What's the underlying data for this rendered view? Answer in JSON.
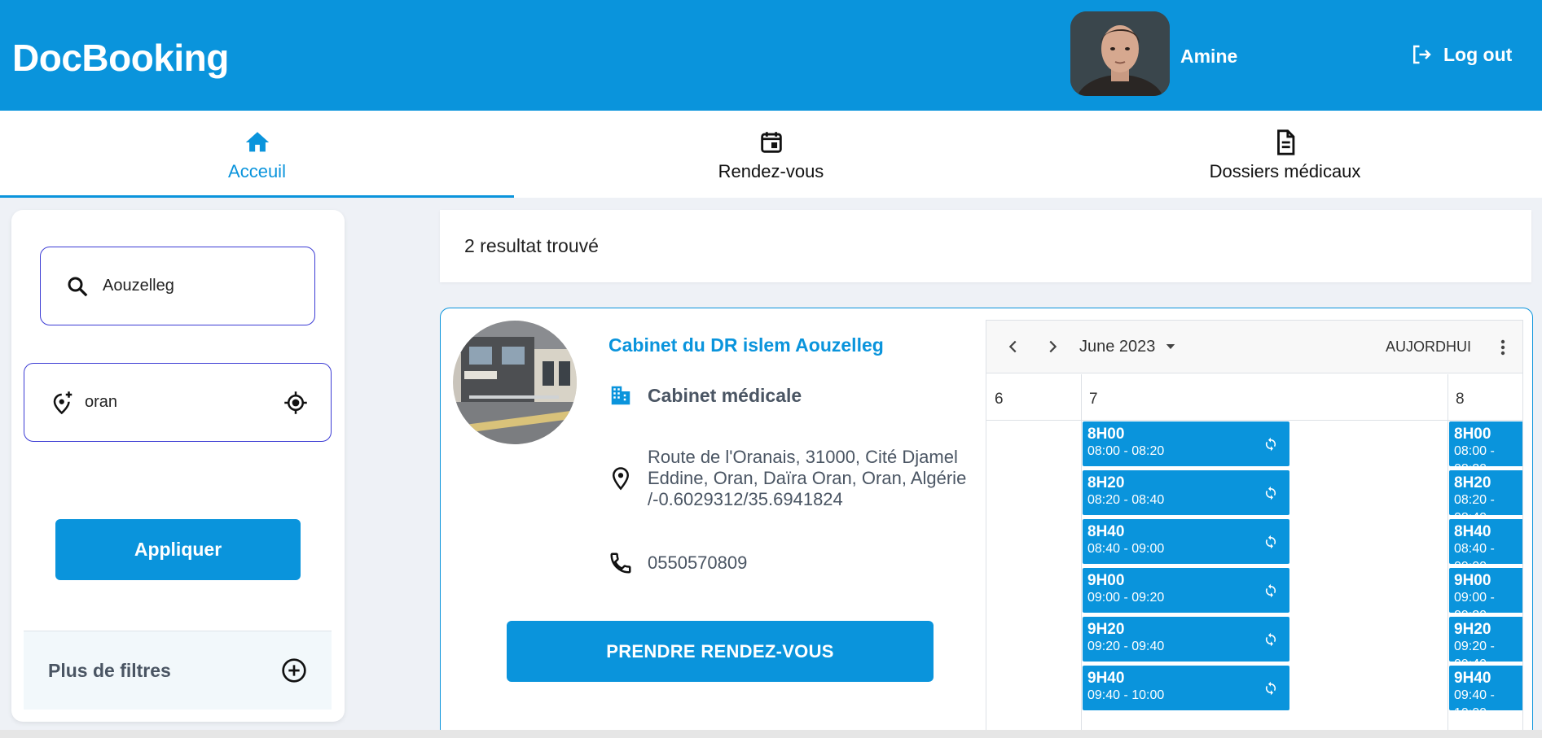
{
  "header": {
    "brand": "DocBooking",
    "user_name": "Amine",
    "logout_label": "Log out"
  },
  "tabs": [
    {
      "label": "Acceuil",
      "icon": "home-icon",
      "active": true
    },
    {
      "label": "Rendez-vous",
      "icon": "calendar-icon",
      "active": false
    },
    {
      "label": "Dossiers médicaux",
      "icon": "document-icon",
      "active": false
    }
  ],
  "filters": {
    "search_value": "Aouzelleg",
    "location_value": "oran",
    "apply_label": "Appliquer",
    "more_filters_label": "Plus de filtres"
  },
  "results": {
    "count_text": "2 resultat trouvé"
  },
  "clinic": {
    "name": "Cabinet du DR islem Aouzelleg",
    "type": "Cabinet médicale",
    "address": "Route de l'Oranais, 31000, Cité Djamel Eddine, Oran, Daïra Oran, Oran, Algérie /-0.6029312/35.6941824",
    "phone": "0550570809",
    "book_label": "PRENDRE RENDEZ-VOUS"
  },
  "calendar": {
    "month_label": "June 2023",
    "today_label": "AUJORDHUI",
    "days": [
      "6",
      "7",
      "8"
    ],
    "slots": [
      {
        "title": "8H00",
        "range": "08:00 - 08:20"
      },
      {
        "title": "8H20",
        "range": "08:20 - 08:40"
      },
      {
        "title": "8H40",
        "range": "08:40 - 09:00"
      },
      {
        "title": "9H00",
        "range": "09:00 - 09:20"
      },
      {
        "title": "9H20",
        "range": "09:20 - 09:40"
      },
      {
        "title": "9H40",
        "range": "09:40 - 10:00"
      }
    ]
  },
  "colors": {
    "primary": "#0a94dc",
    "input_border": "#3b3bd4",
    "muted_text": "#4a5563"
  }
}
